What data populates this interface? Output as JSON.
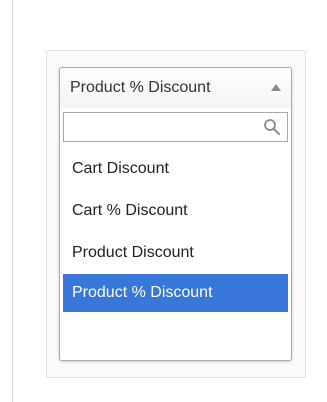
{
  "dropdown": {
    "selected_label": "Product % Discount",
    "search": {
      "value": "",
      "placeholder": ""
    },
    "options": [
      {
        "label": "Cart Discount"
      },
      {
        "label": "Cart % Discount"
      },
      {
        "label": "Product Discount"
      },
      {
        "label": "Product % Discount"
      }
    ],
    "highlighted_index": 3
  },
  "colors": {
    "highlight": "#3876d9",
    "highlight_text": "#ffffff",
    "border": "#a9a9a9"
  },
  "icons": {
    "toggle": "chevron-up-icon",
    "search": "search-icon"
  }
}
